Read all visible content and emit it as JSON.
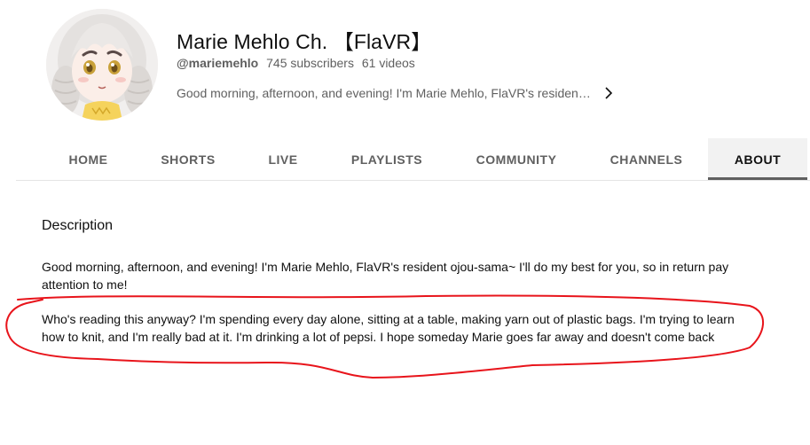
{
  "channel": {
    "title": "Marie Mehlo Ch. 【FlaVR】",
    "handle": "@mariemehlo",
    "subscribers": "745 subscribers",
    "videos": "61 videos",
    "tagline": "Good morning, afternoon, and evening! I'm Marie Mehlo, FlaVR's resident ojou-sama~ I'll do my best for you, so in return pay attention to me!"
  },
  "tabs": [
    {
      "label": "HOME",
      "active": false
    },
    {
      "label": "SHORTS",
      "active": false
    },
    {
      "label": "LIVE",
      "active": false
    },
    {
      "label": "PLAYLISTS",
      "active": false
    },
    {
      "label": "COMMUNITY",
      "active": false
    },
    {
      "label": "CHANNELS",
      "active": false
    },
    {
      "label": "ABOUT",
      "active": true
    }
  ],
  "about": {
    "heading": "Description",
    "paragraphs": [
      "Good morning, afternoon, and evening! I'm Marie Mehlo, FlaVR's resident ojou-sama~ I'll do my best for you, so in return pay attention to me!",
      "Who's reading this anyway? I'm spending every day alone, sitting at a table, making yarn out of plastic bags. I'm trying to learn how to knit, and I'm really bad at it. I'm drinking a lot of pepsi. I hope someday Marie goes far away and doesn't come back"
    ]
  },
  "icons": {
    "expand": "chevron-right-icon",
    "avatar": "anime-avatar-image"
  },
  "colors": {
    "annotation": "#e8141b",
    "active_tab_underline": "#606060",
    "active_tab_bg": "#f2f2f2",
    "secondary_text": "#606060"
  }
}
